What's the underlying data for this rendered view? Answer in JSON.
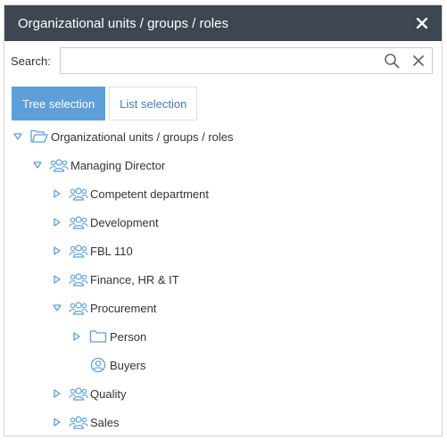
{
  "dialog": {
    "title": "Organizational units / groups / roles"
  },
  "search": {
    "label": "Search:",
    "value": "",
    "placeholder": ""
  },
  "tabs": [
    {
      "label": "Tree selection",
      "active": true
    },
    {
      "label": "List selection",
      "active": false
    }
  ],
  "tree": [
    {
      "label": "Organizational units / groups / roles",
      "icon": "folder-open-icon",
      "state": "expanded"
    },
    {
      "label": "Managing Director",
      "icon": "group-icon",
      "state": "expanded"
    },
    {
      "label": "Competent department",
      "icon": "group-icon",
      "state": "collapsed"
    },
    {
      "label": "Development",
      "icon": "group-icon",
      "state": "collapsed"
    },
    {
      "label": "FBL 110",
      "icon": "group-icon",
      "state": "collapsed"
    },
    {
      "label": "Finance, HR & IT",
      "icon": "group-icon",
      "state": "collapsed"
    },
    {
      "label": "Procurement",
      "icon": "group-icon",
      "state": "expanded"
    },
    {
      "label": "Person",
      "icon": "folder-icon",
      "state": "collapsed"
    },
    {
      "label": "Buyers",
      "icon": "role-icon",
      "state": "leaf"
    },
    {
      "label": "Quality",
      "icon": "group-icon",
      "state": "collapsed"
    },
    {
      "label": "Sales",
      "icon": "group-icon",
      "state": "collapsed"
    }
  ],
  "colors": {
    "titlebar": "#3e4751",
    "accent": "#5c9fd9",
    "icon": "#5c9fd9"
  }
}
